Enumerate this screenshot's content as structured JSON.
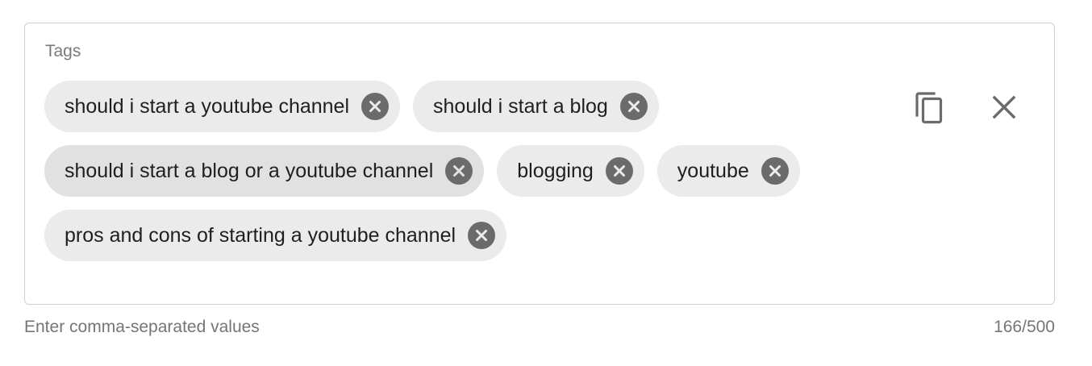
{
  "field": {
    "label": "Tags",
    "helper_text": "Enter comma-separated values",
    "counter": "166/500"
  },
  "tags": [
    {
      "label": "should i start a youtube channel",
      "remove_icon": "close-circle-icon"
    },
    {
      "label": "should i start a blog",
      "remove_icon": "close-circle-icon"
    },
    {
      "label": "should i start a blog or a youtube channel",
      "remove_icon": "close-circle-icon"
    },
    {
      "label": "blogging",
      "remove_icon": "close-circle-icon"
    },
    {
      "label": "youtube",
      "remove_icon": "close-circle-icon"
    },
    {
      "label": "pros and cons of starting a youtube channel",
      "remove_icon": "close-circle-icon"
    }
  ],
  "actions": {
    "copy_icon": "copy-icon",
    "clear_icon": "close-icon"
  },
  "colors": {
    "chip_background": "#ebebeb",
    "chip_hover_background": "#e1e1e1",
    "icon_gray": "#6b6b6b",
    "border": "#cfcfcf"
  }
}
